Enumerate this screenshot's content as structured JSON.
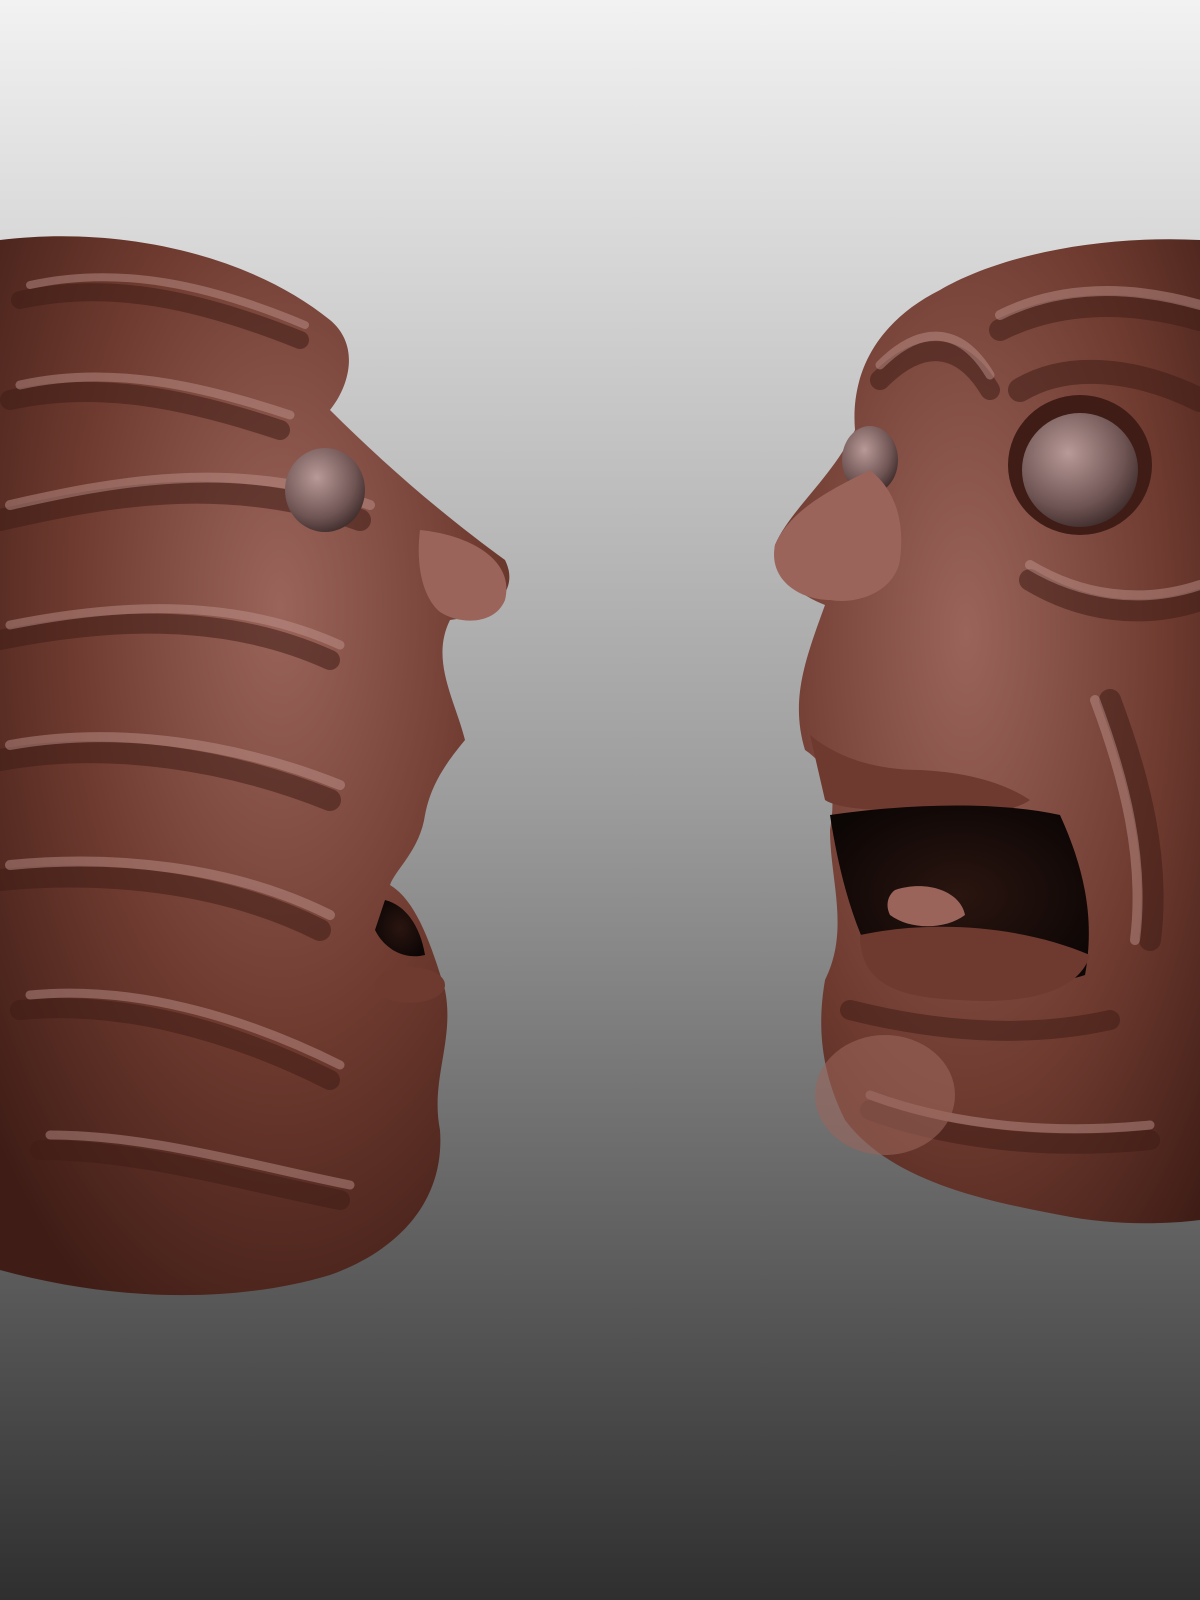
{
  "scene": {
    "subjects": [
      {
        "id": "left-head",
        "kind": "sculpted-head",
        "facing": "right"
      },
      {
        "id": "right-head",
        "kind": "sculpted-head",
        "facing": "left"
      }
    ],
    "colors": {
      "background_top": "#f2f2f2",
      "background_mid": "#9c9c9c",
      "background_bottom": "#2f2f2f",
      "clay_dark": "#3f1d16",
      "clay_base": "#6e3a2f",
      "clay_light": "#9a645a",
      "clay_highlight": "#c49a92",
      "mouth_interior": "#1a0d0a"
    }
  }
}
